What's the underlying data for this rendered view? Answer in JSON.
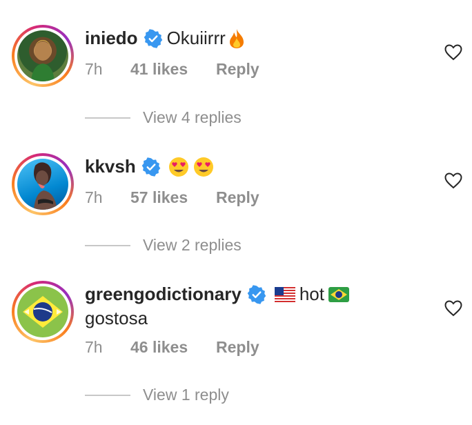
{
  "comments": [
    {
      "username": "iniedo",
      "text": "Okuiirrr",
      "text_emoji": "fire-emoji",
      "time": "7h",
      "likes": "41 likes",
      "reply": "Reply",
      "view_replies": "View 4 replies"
    },
    {
      "username": "kkvsh",
      "text": "",
      "text_emoji": "heart-eyes-emoji x2",
      "time": "7h",
      "likes": "57 likes",
      "reply": "Reply",
      "view_replies": "View 2 replies"
    },
    {
      "username": "greengodictionary",
      "text": "hot",
      "text_line2": "gostosa",
      "flags": [
        "us-flag-emoji",
        "brazil-flag-emoji"
      ],
      "time": "7h",
      "likes": "46 likes",
      "reply": "Reply",
      "view_replies": "View 1 reply"
    }
  ],
  "colors": {
    "verified": "#3897f0",
    "secondary_text": "#8e8e8e",
    "primary_text": "#262626"
  }
}
